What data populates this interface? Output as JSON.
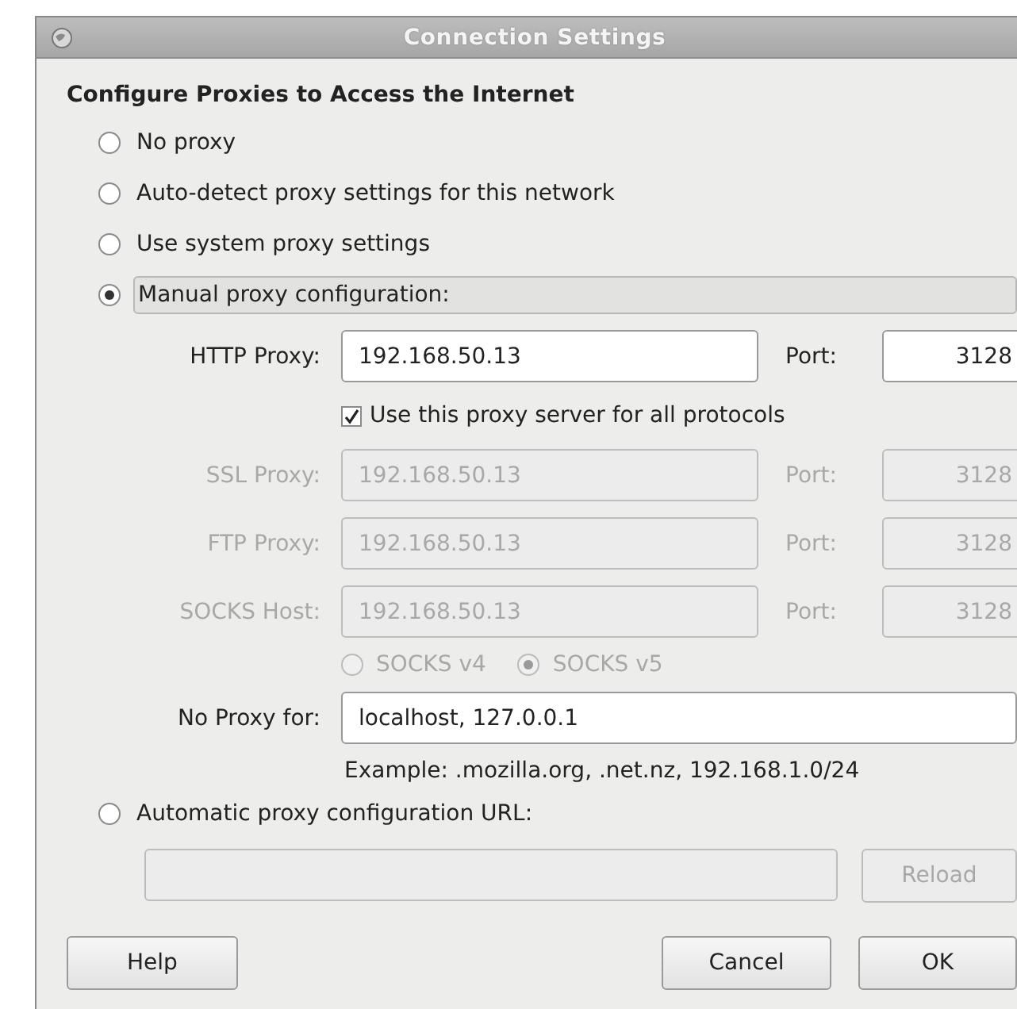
{
  "window": {
    "title": "Connection Settings"
  },
  "heading": "Configure Proxies to Access the Internet",
  "modes": [
    {
      "label": "No proxy",
      "selected": false,
      "hovered": false
    },
    {
      "label": "Auto-detect proxy settings for this network",
      "selected": false,
      "hovered": false
    },
    {
      "label": "Use system proxy settings",
      "selected": false,
      "hovered": false
    },
    {
      "label": "Manual proxy configuration:",
      "selected": true,
      "hovered": true
    }
  ],
  "http": {
    "label": "HTTP Proxy:",
    "value": "192.168.50.13",
    "disabled": false,
    "port_label": "Port:",
    "port": "3128"
  },
  "share_all": {
    "label": "Use this proxy server for all protocols",
    "checked": true
  },
  "proxies": [
    {
      "label": "SSL Proxy:",
      "value": "192.168.50.13",
      "disabled": true,
      "port_label": "Port:",
      "port": "3128"
    },
    {
      "label": "FTP Proxy:",
      "value": "192.168.50.13",
      "disabled": true,
      "port_label": "Port:",
      "port": "3128"
    },
    {
      "label": "SOCKS Host:",
      "value": "192.168.50.13",
      "disabled": true,
      "port_label": "Port:",
      "port": "3128"
    }
  ],
  "socks_versions": [
    {
      "label": "SOCKS v4",
      "selected": false,
      "disabled": true
    },
    {
      "label": "SOCKS v5",
      "selected": true,
      "disabled": true
    }
  ],
  "no_proxy": {
    "label": "No Proxy for:",
    "value": "localhost, 127.0.0.1",
    "example": "Example: .mozilla.org, .net.nz, 192.168.1.0/24"
  },
  "auto_config": {
    "label": "Automatic proxy configuration URL:",
    "selected": false,
    "url_disabled": true,
    "reload": {
      "label": "Reload",
      "disabled": true
    }
  },
  "buttons": [
    {
      "label": "Help",
      "kind": "help"
    },
    {
      "label": "Cancel",
      "kind": "action"
    },
    {
      "label": "OK",
      "kind": "action"
    }
  ]
}
